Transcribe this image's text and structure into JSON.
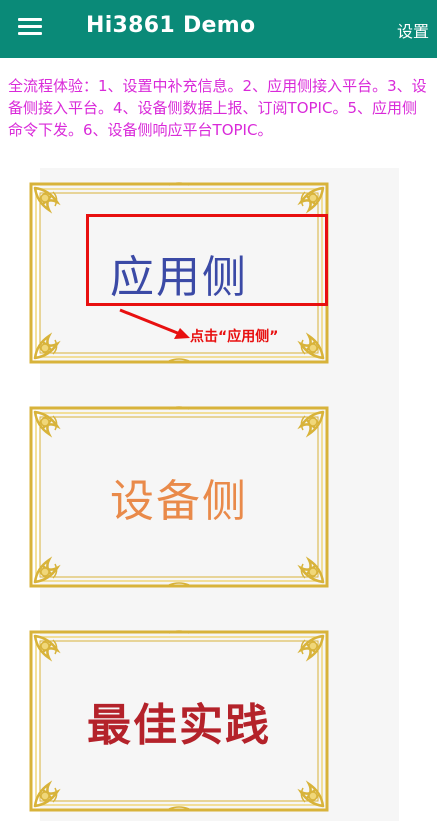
{
  "appbar": {
    "title": "Hi3861 Demo",
    "settings_label": "设置",
    "background_color": "#0a8a78"
  },
  "description": "全流程体验：1、设置中补充信息。2、应用侧接入平台。3、设备侧接入平台。4、设备侧数据上报、订阅TOPIC。5、应用侧命令下发。6、设备侧响应平台TOPIC。",
  "cards": [
    {
      "label": "应用侧",
      "color": "#3b4aa6"
    },
    {
      "label": "设备侧",
      "color": "#e98a4a"
    },
    {
      "label": "最佳实践",
      "color": "#b4222a"
    }
  ],
  "annotation": {
    "hint": "点击“应用侧”",
    "color": "#e81010"
  }
}
